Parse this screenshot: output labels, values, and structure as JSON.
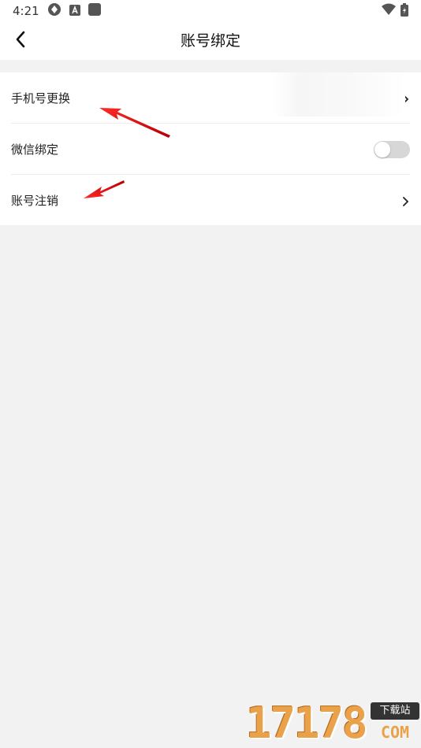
{
  "status_bar": {
    "time": "4:21",
    "left_icons": [
      "sync-icon",
      "a-badge-icon",
      "square-icon"
    ],
    "right_icons": [
      "wifi-icon",
      "battery-icon"
    ]
  },
  "header": {
    "title": "账号绑定",
    "back_icon": "chevron-left-icon"
  },
  "settings": {
    "rows": [
      {
        "label": "手机号更换",
        "control": "chevron"
      },
      {
        "label": "微信绑定",
        "control": "toggle",
        "toggle_on": false
      },
      {
        "label": "账号注销",
        "control": "chevron"
      }
    ]
  },
  "annotation": {
    "arrow_color": "#e02020"
  },
  "watermark": {
    "number": "17178",
    "badge": "下载站",
    "suffix": "COM"
  }
}
